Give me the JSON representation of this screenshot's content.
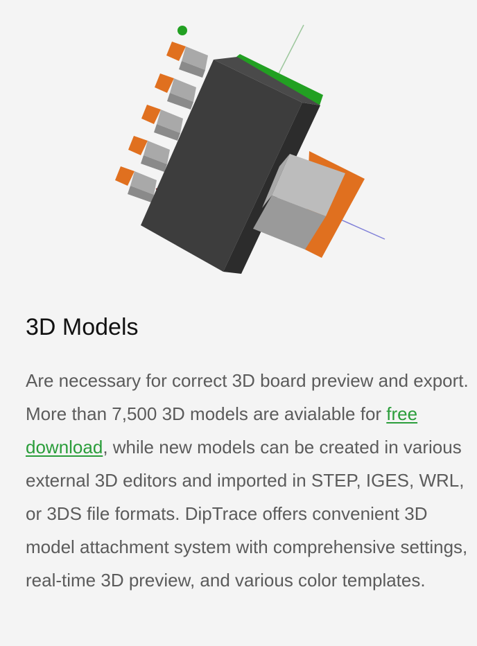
{
  "section": {
    "title": "3D Models",
    "paragraph": {
      "before_link": "Are necessary for correct 3D board preview and export. More than 7,500 3D models are avialable for ",
      "link_text": "free download",
      "after_link": ", while new models can be created in various external 3D editors and imported in STEP, IGES, WRL, or 3DS file formats. DipTrace offers convenient 3D model attachment system with comprehensive settings, real-time 3D preview, and various color templates."
    }
  },
  "figure": {
    "icon": "component-3d-model-icon",
    "colors": {
      "body": "#3d3d3d",
      "pins": "#e0701f",
      "leads": "#a9a9a9",
      "marker": "#22a022",
      "accent_link": "#2a9d3a"
    }
  }
}
